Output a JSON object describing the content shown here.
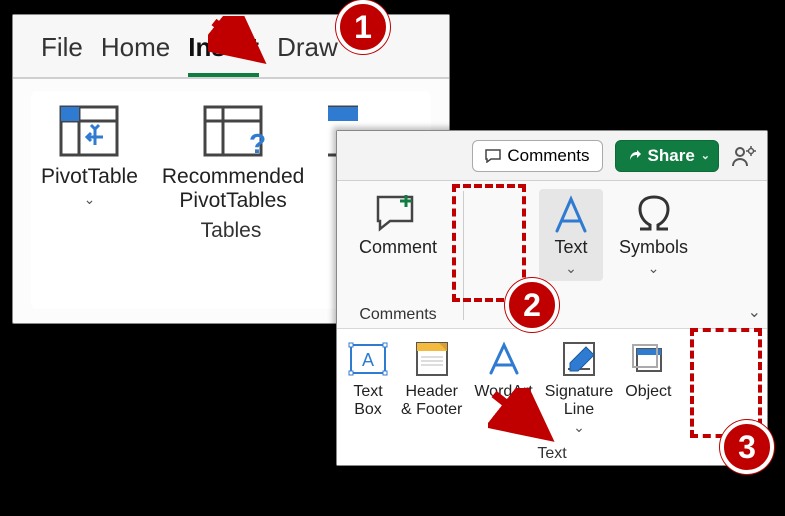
{
  "tabs": {
    "file": "File",
    "home": "Home",
    "insert": "Insert",
    "draw": "Draw",
    "active": "Insert"
  },
  "tablesGroup": {
    "pivot": "PivotTable",
    "rec": "Recommended\nPivotTables",
    "label": "Tables"
  },
  "topbar": {
    "comments": "Comments",
    "share": "Share"
  },
  "midGroups": {
    "comment_item": "Comment",
    "comments_label": "Comments",
    "text_item": "Text",
    "symbols_item": "Symbols"
  },
  "dropdown": {
    "textbox": "Text\nBox",
    "header": "Header\n& Footer",
    "wordart": "WordArt",
    "sig": "Signature\nLine",
    "object": "Object",
    "label": "Text"
  },
  "annotations": {
    "n1": "1",
    "n2": "2",
    "n3": "3"
  }
}
